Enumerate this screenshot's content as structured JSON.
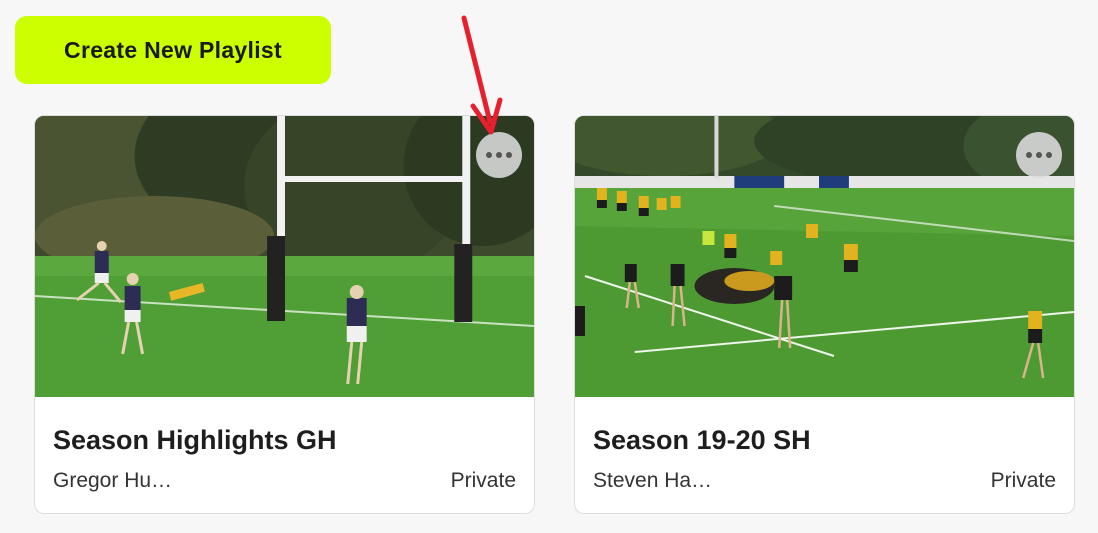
{
  "toolbar": {
    "create_label": "Create New Playlist"
  },
  "playlists": [
    {
      "title": "Season Highlights GH",
      "owner": "Gregor Hu…",
      "privacy": "Private",
      "thumbnail_icon": "rugby-try-image"
    },
    {
      "title": "Season 19-20 SH",
      "owner": "Steven Ha…",
      "privacy": "Private",
      "thumbnail_icon": "rugby-ruck-image"
    }
  ],
  "colors": {
    "accent": "#ccff00",
    "arrow": "#e8202e"
  }
}
